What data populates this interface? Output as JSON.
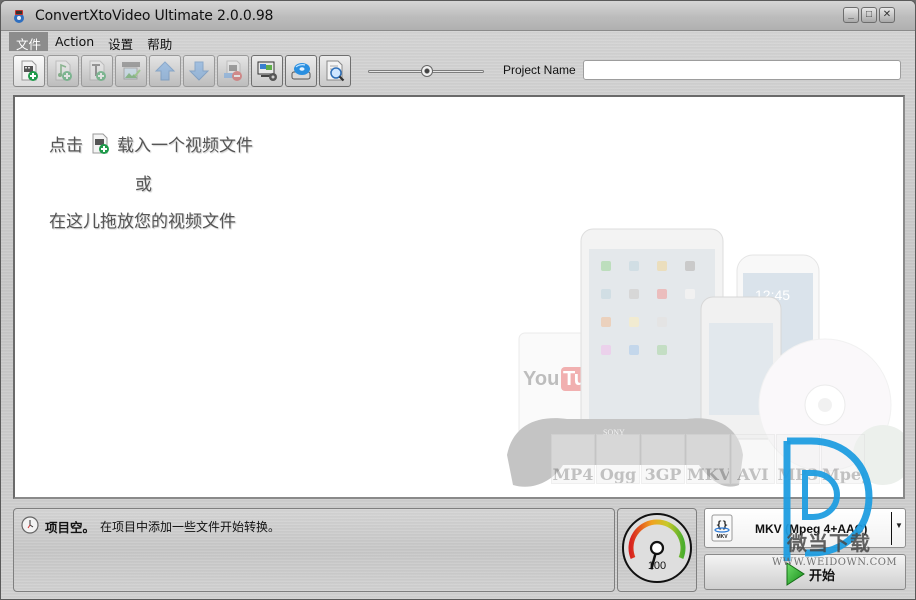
{
  "window": {
    "title": "ConvertXtoVideo Ultimate 2.0.0.98",
    "controls": {
      "minimize": "_",
      "maximize": "□",
      "close": "✕"
    }
  },
  "menu": [
    {
      "label": "文件",
      "active": true
    },
    {
      "label": "Action",
      "active": false
    },
    {
      "label": "设置",
      "active": false
    },
    {
      "label": "帮助",
      "active": false
    }
  ],
  "toolbar": {
    "buttons": [
      {
        "name": "add-video-file",
        "icon": "film-add-icon",
        "enabled": true
      },
      {
        "name": "add-audio",
        "icon": "music-add-icon",
        "enabled": false
      },
      {
        "name": "add-subtitle",
        "icon": "text-add-icon",
        "enabled": false
      },
      {
        "name": "edit-menu",
        "icon": "image-edit-icon",
        "enabled": false
      },
      {
        "name": "move-up",
        "icon": "arrow-up-icon",
        "enabled": false
      },
      {
        "name": "move-down",
        "icon": "arrow-down-icon",
        "enabled": false
      },
      {
        "name": "remove",
        "icon": "remove-file-icon",
        "enabled": false
      },
      {
        "name": "settings",
        "icon": "monitor-gear-icon",
        "enabled": true
      },
      {
        "name": "burn-disc",
        "icon": "disc-drive-icon",
        "enabled": true
      },
      {
        "name": "preview",
        "icon": "document-search-icon",
        "enabled": true
      }
    ],
    "slider_value": 0.5,
    "project_name_label": "Project Name",
    "project_name_value": ""
  },
  "main": {
    "hint_click": "点击",
    "hint_load": "载入一个视频文件",
    "hint_or": "或",
    "hint_drop": "在这儿拖放您的视频文件",
    "format_badges": [
      "MP4",
      "Ogg",
      "3GP",
      "MKV",
      "AVI",
      "MP3",
      "Mpeg"
    ],
    "device_labels": {
      "phone_time": "12:45",
      "youtube": "YouTube",
      "sony": "SONY"
    }
  },
  "status": {
    "title": "项目空。",
    "message": "在项目中添加一些文件开始转换。"
  },
  "gauge": {
    "value": "100",
    "level": 1.0
  },
  "output": {
    "format_label": "MKV (Mpeg 4+AAC)",
    "format_icon_text": "MKV",
    "start_label": "开始"
  },
  "watermark": {
    "brand": "微当下载",
    "url": "WWW.WEIDOWN.COM",
    "color": "#1f9de0"
  }
}
